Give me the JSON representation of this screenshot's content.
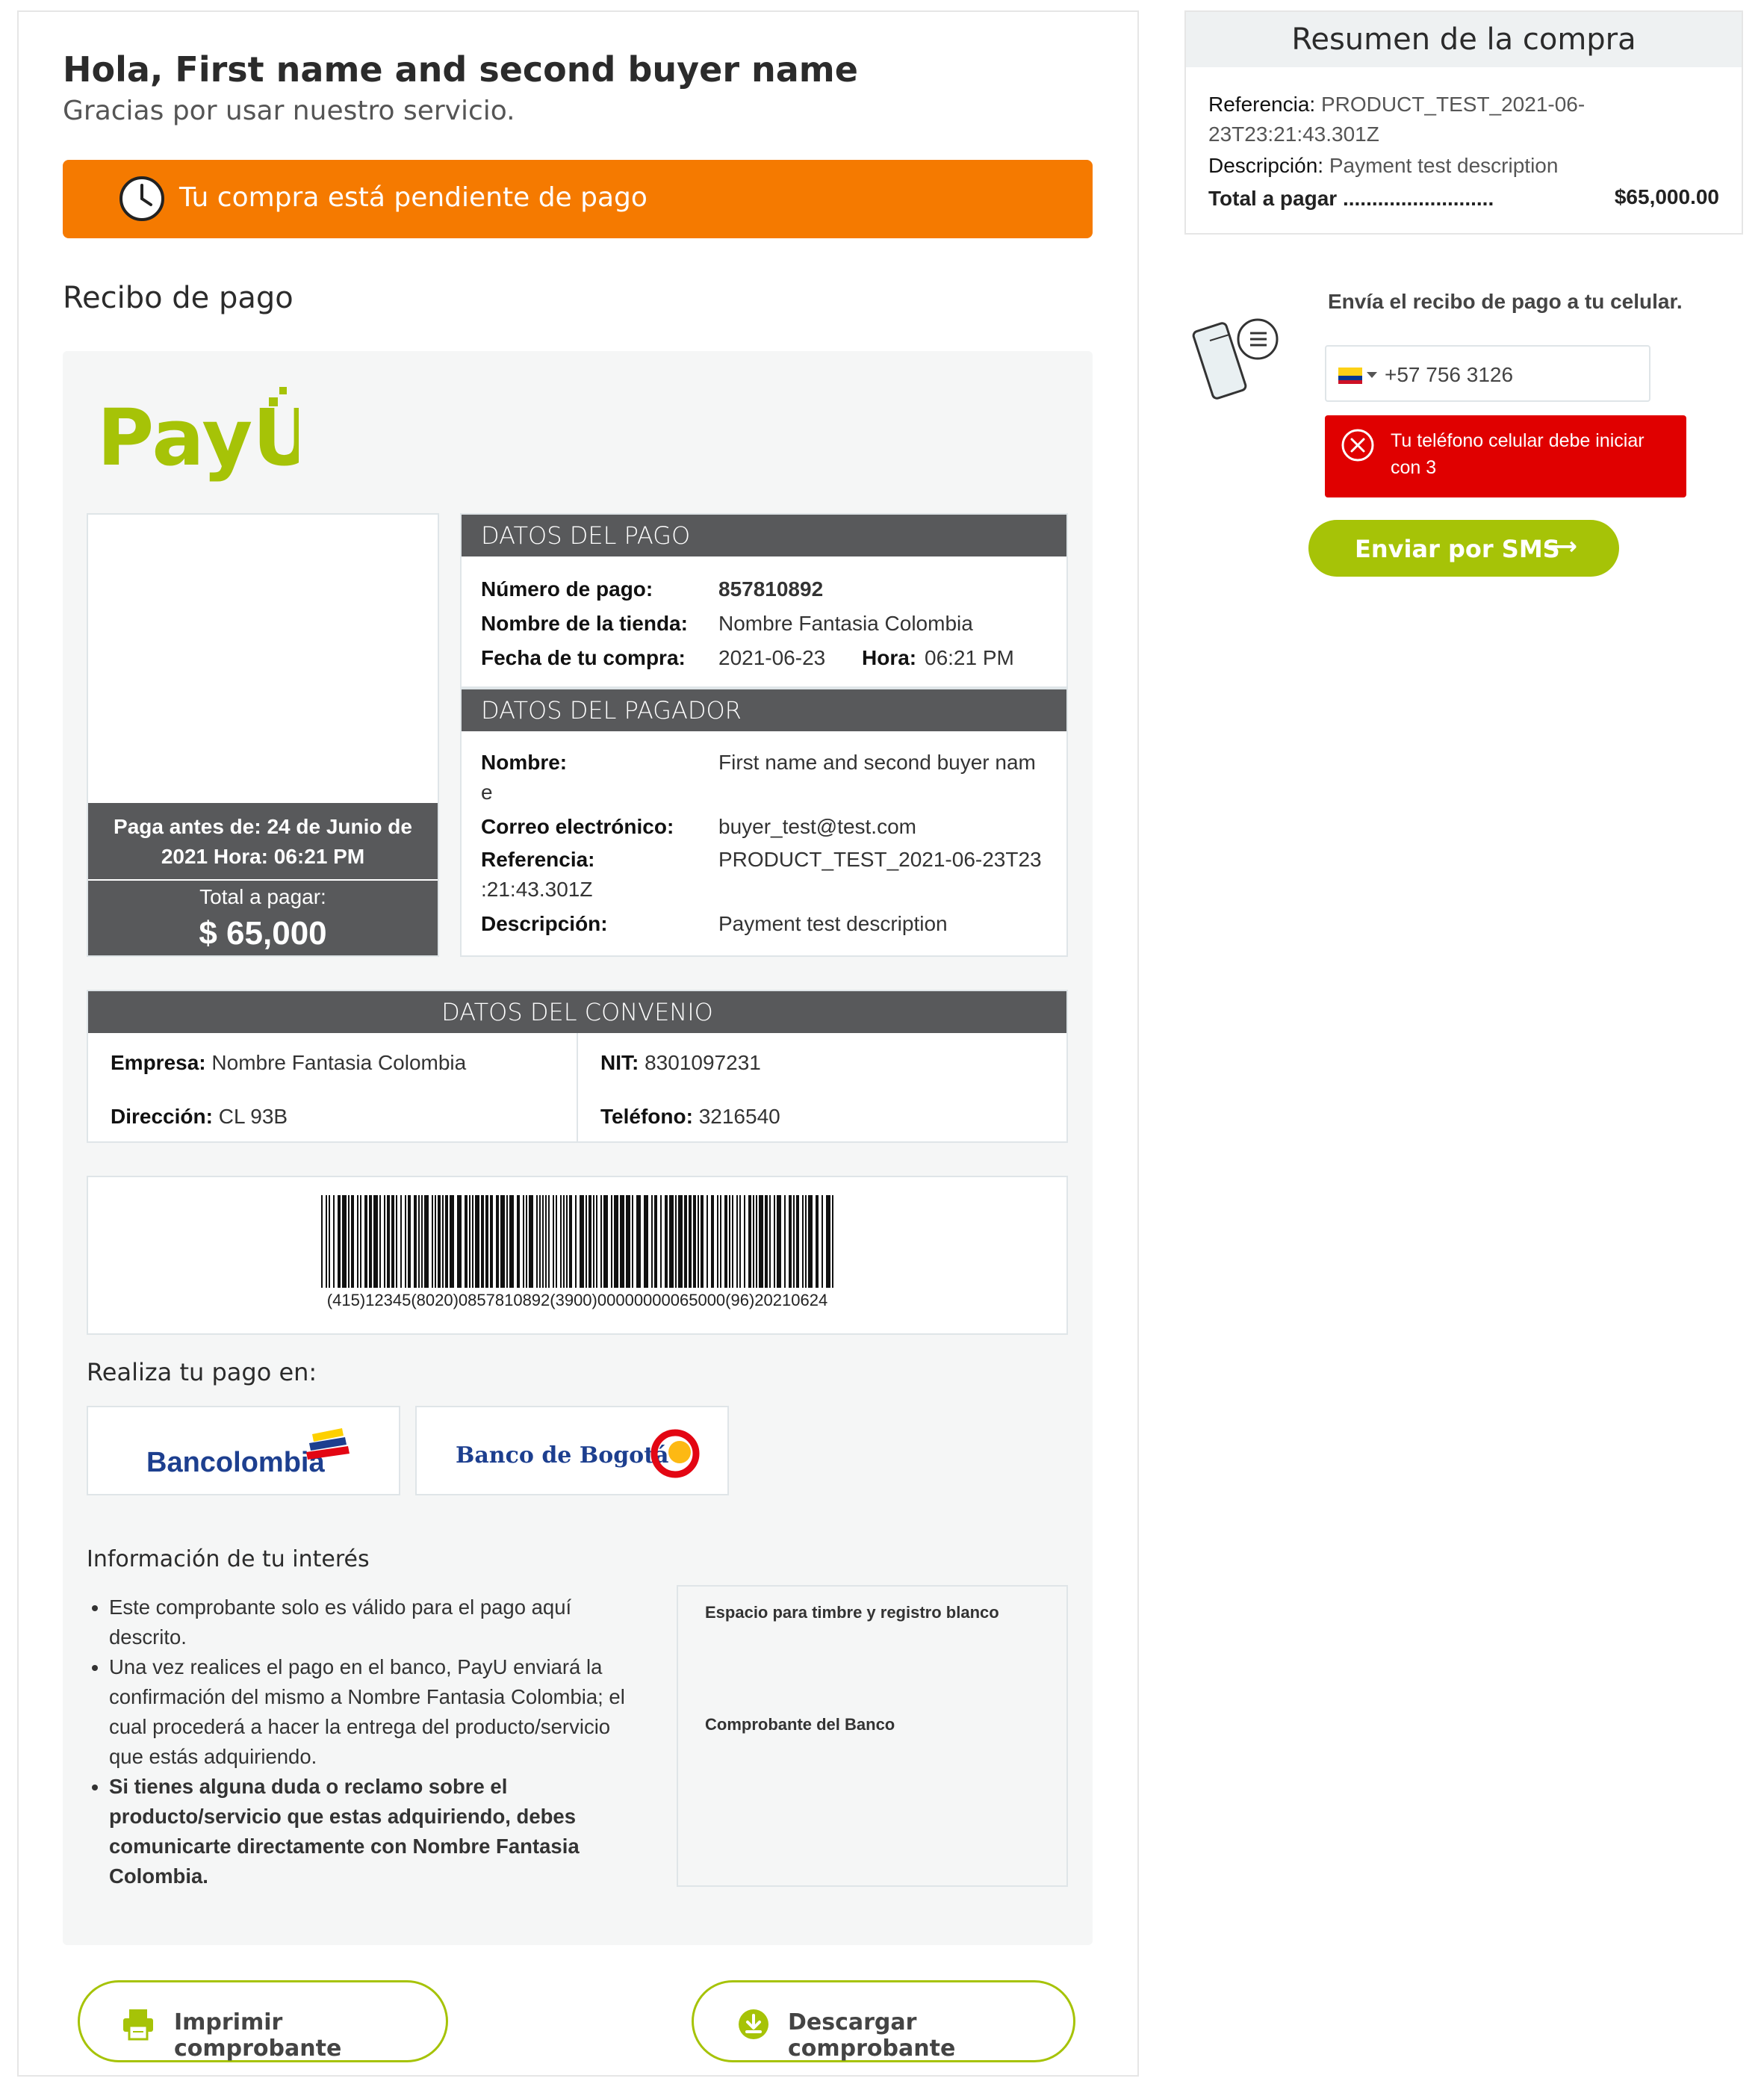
{
  "greeting": {
    "title": "Hola, First name and second buyer name",
    "subtitle": "Gracias por usar nuestro servicio."
  },
  "status": {
    "label": "Tu compra está pendiente de pago",
    "color": "#f57a00",
    "icon": "clock-icon"
  },
  "receipt": {
    "title": "Recibo de pago",
    "brand": "PayU",
    "due_label": "Paga antes de: 24 de Junio de 2021 Hora: 06:21 PM",
    "total_label": "Total a pagar:",
    "total_value": "$ 65,000",
    "payment": {
      "header": "DATOS DEL PAGO",
      "number_label": "Número de pago:",
      "number_value": "857810892",
      "store_label": "Nombre de la tienda:",
      "store_value": "Nombre Fantasia Colombia",
      "date_label": "Fecha de tu compra:",
      "date_value": "2021-06-23",
      "time_label": "Hora:",
      "time_value": "06:21 PM"
    },
    "payer": {
      "header": "DATOS DEL PAGADOR",
      "name_label": "Nombre:",
      "name_value": "First name and second buyer nam",
      "name_wrap": "e",
      "email_label": "Correo electrónico:",
      "email_value": "buyer_test@test.com",
      "ref_label": "Referencia:",
      "ref_value": "PRODUCT_TEST_2021-06-23T23",
      "ref_wrap": ":21:43.301Z",
      "desc_label": "Descripción:",
      "desc_value": "Payment test description"
    },
    "agreement": {
      "header": "DATOS DEL CONVENIO",
      "company_label": "Empresa:",
      "company_value": "Nombre Fantasia Colombia",
      "nit_label": "NIT:",
      "nit_value": "8301097231",
      "address_label": "Dirección:",
      "address_value": "CL 93B",
      "phone_label": "Teléfono:",
      "phone_value": "3216540"
    },
    "barcode_text": "(415)12345(8020)0857810892(3900)00000000065000(96)20210624",
    "pay_at_label": "Realiza tu pago en:",
    "banks": [
      "Bancolombia",
      "Banco de Bogotá"
    ],
    "info_title": "Información de tu interés",
    "info_items": [
      "Este comprobante solo es válido para el pago aquí descrito.",
      "Una vez realices el pago en el banco, PayU enviará la confirmación del mismo a Nombre Fantasia Colombia; el cual procederá a hacer la entrega del producto/servicio que estás adquiriendo.",
      "Si tienes alguna duda o reclamo sobre el producto/servicio que estas adquiriendo, debes comunicarte directamente con Nombre Fantasia Colombia."
    ],
    "stamp_label": "Espacio para timbre y registro blanco",
    "bank_receipt_label": "Comprobante del Banco"
  },
  "actions": {
    "print": "Imprimir comprobante",
    "download": "Descargar comprobante"
  },
  "summary": {
    "title": "Resumen de la compra",
    "ref_label": "Referencia:",
    "ref_value": "PRODUCT_TEST_2021-06-",
    "ref_wrap": "23T23:21:43.301Z",
    "desc_label": "Descripción:",
    "desc_value": "Payment test description",
    "total_label": "Total a pagar",
    "total_dots": "..........................",
    "total_value": "$65,000.00"
  },
  "sms": {
    "title": "Envía el recibo de pago a tu celular.",
    "phone_value": "+57 756 3126",
    "error": "Tu teléfono celular debe iniciar con 3",
    "button": "Enviar por SMS",
    "arrow": "⟶"
  },
  "colors": {
    "accent_green": "#a6c307",
    "dark_header": "#58595b",
    "error_red": "#e00000"
  }
}
